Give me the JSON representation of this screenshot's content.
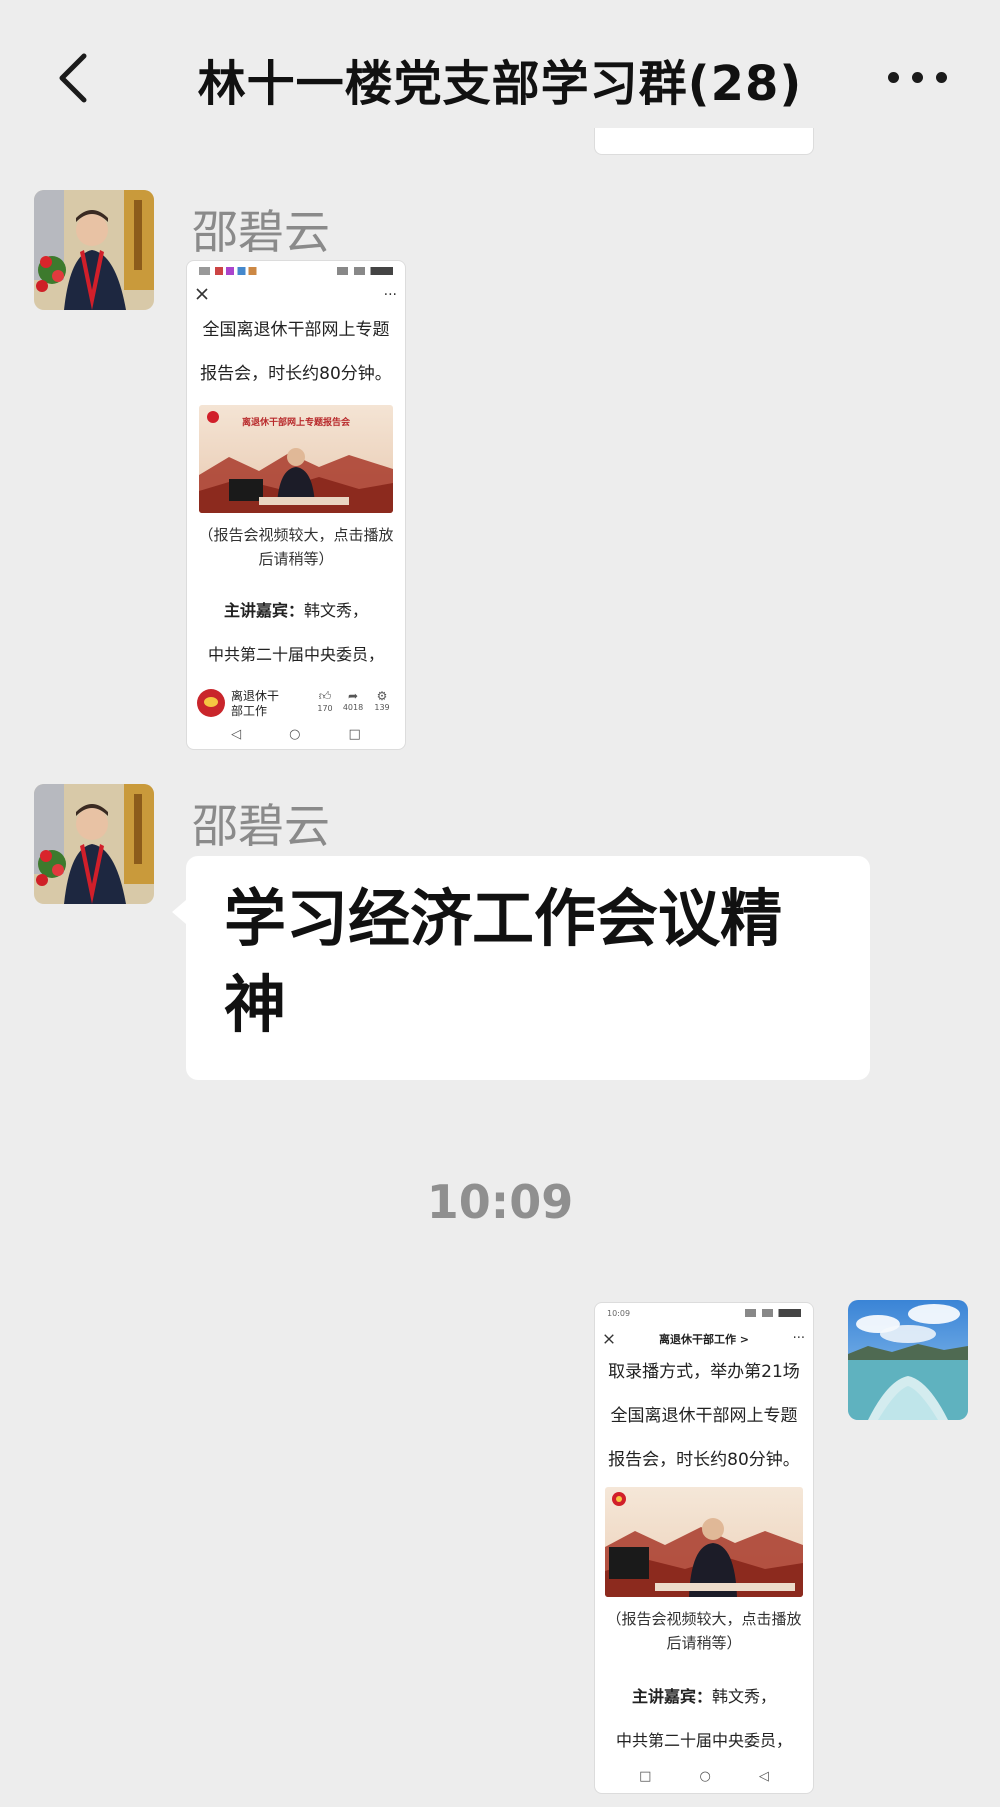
{
  "header": {
    "title": "林十一楼党支部学习群(28)"
  },
  "messages": [
    {
      "sender": "邵碧云",
      "type": "image",
      "screenshot": {
        "line1": "全国离退休干部网上专题",
        "line2": "报告会，时长约80分钟。",
        "video_banner": "离退休干部网上专题报告会",
        "caption_line1": "（报告会视频较大，点击播放",
        "caption_line2": "后请稍等）",
        "speaker_label": "主讲嘉宾：",
        "speaker_name": "韩文秀，",
        "speaker_title": "中共第二十届中央委员，",
        "account_name_line1": "离退休干",
        "account_name_line2": "部工作",
        "likes": "170",
        "shares": "4018",
        "views": "139"
      }
    },
    {
      "sender": "邵碧云",
      "type": "text",
      "text": "学习经济工作会议精神"
    },
    {
      "type": "timestamp",
      "time": "10:09"
    },
    {
      "type": "image",
      "self": true,
      "screenshot": {
        "status_time": "10:09",
        "topbar_title": "离退休干部工作 >",
        "line0": "取录播方式，举办第21场",
        "line1": "全国离退休干部网上专题",
        "line2": "报告会，时长约80分钟。",
        "caption_line1": "（报告会视频较大，点击播放",
        "caption_line2": "后请稍等）",
        "speaker_label": "主讲嘉宾：",
        "speaker_name": "韩文秀，",
        "speaker_title": "中共第二十届中央委员，"
      }
    }
  ],
  "colors": {
    "background": "#ededed",
    "bubble": "#ffffff",
    "sender_name": "#8a8a8a",
    "timestamp": "#8f8f8f"
  },
  "icons": [
    "back-icon",
    "more-icon",
    "close-icon",
    "like-icon",
    "share-icon",
    "settings-icon"
  ]
}
